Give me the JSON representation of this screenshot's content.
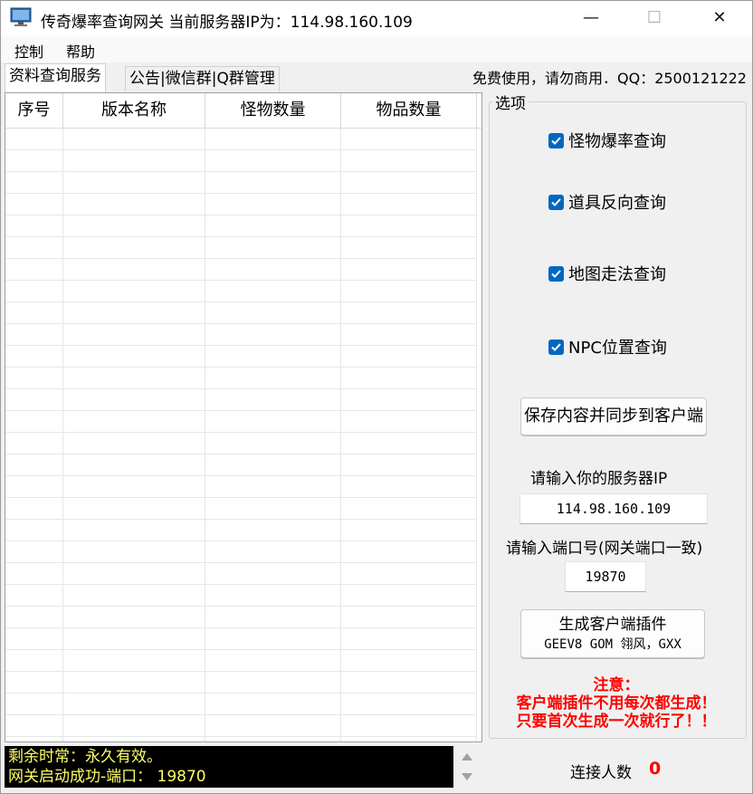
{
  "window": {
    "title": "传奇爆率查询网关 当前服务器IP为：114.98.160.109",
    "minimize_label": "—",
    "maximize_label": "☐",
    "close_label": "✕"
  },
  "menu": {
    "items": [
      "控制",
      "帮助"
    ]
  },
  "tabs": [
    {
      "label": "资料查询服务",
      "active": true
    },
    {
      "label": "公告|微信群|Q群管理",
      "active": false
    }
  ],
  "notice_top": "免费使用，请勿商用．QQ：2500121222",
  "grid": {
    "columns": [
      "序号",
      "版本名称",
      "怪物数量",
      "物品数量"
    ],
    "rows": []
  },
  "options": {
    "legend": "选项",
    "checkboxes": [
      {
        "label": "怪物爆率查询",
        "checked": true
      },
      {
        "label": "道具反向查询",
        "checked": true
      },
      {
        "label": "地图走法查询",
        "checked": true
      },
      {
        "label": "NPC位置查询",
        "checked": true
      }
    ],
    "save_button": "保存内容并同步到客户端",
    "server_ip_label": "请输入你的服务器IP",
    "server_ip_value": "114.98.160.109",
    "port_label": "请输入端口号(网关端口一致)",
    "port_value": "19870",
    "generate_button_line1": "生成客户端插件",
    "generate_button_line2": "GEEV8 GOM 翎风，GXX",
    "warning": {
      "line1": "注意：",
      "line2": "客户端插件不用每次都生成！",
      "line3": "只要首次生成一次就行了！！"
    }
  },
  "log": {
    "line1": "剩余时常：永久有效。",
    "line2": "网关启动成功-端口：  19870"
  },
  "status": {
    "connections_label": "连接人数",
    "connections_value": "0"
  },
  "colors": {
    "accent": "#0067c0",
    "warning": "#ff0000",
    "log_text": "#ffff66",
    "log_bg": "#000000"
  }
}
